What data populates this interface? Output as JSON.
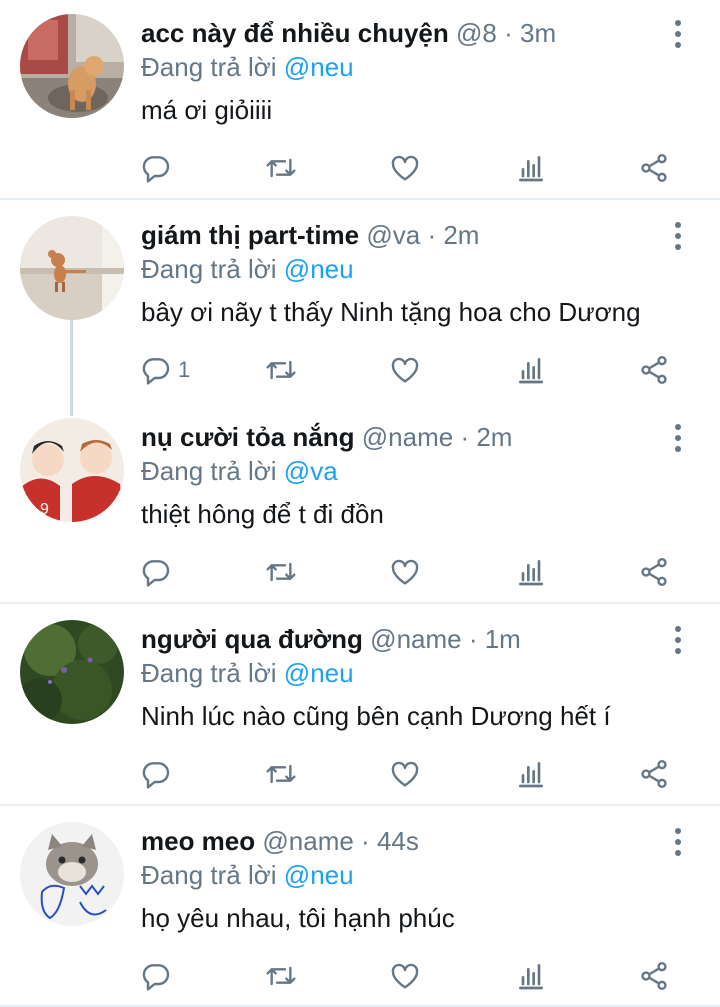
{
  "replying_prefix": "Đang trả lời",
  "tweets": [
    {
      "name": "acc này để nhiều chuyện",
      "handle": "@8",
      "time": "3m",
      "replying_to": "@neu",
      "text": "má ơi giỏiiii",
      "reply_count": "",
      "avatar_icon": "cat-photo-avatar"
    },
    {
      "name": "giám thị part-time",
      "handle": "@va",
      "time": "2m",
      "replying_to": "@neu",
      "text": "bây ơi nãy t thấy Ninh tặng hoa cho Dương",
      "reply_count": "1",
      "avatar_icon": "cartoon-mouse-avatar"
    },
    {
      "name": "nụ cười tỏa nắng",
      "handle": "@name",
      "time": "2m",
      "replying_to": "@va",
      "text": "thiệt hông để t đi đồn",
      "reply_count": "",
      "avatar_icon": "anime-players-avatar"
    },
    {
      "name": "người qua đường",
      "handle": "@name",
      "time": "1m",
      "replying_to": "@neu",
      "text": "Ninh lúc nào cũng bên cạnh Dương hết í",
      "reply_count": "",
      "avatar_icon": "grass-photo-avatar"
    },
    {
      "name": "meo meo",
      "handle": "@name",
      "time": "44s",
      "replying_to": "@neu",
      "text": "họ yêu nhau, tôi hạnh phúc",
      "reply_count": "",
      "avatar_icon": "kitten-doodle-avatar"
    }
  ],
  "colors": {
    "name": "#14171a",
    "meta": "#657786",
    "mention": "#1da1f2",
    "divider": "#e6ecf0",
    "thread_line": "#cfd9de"
  }
}
